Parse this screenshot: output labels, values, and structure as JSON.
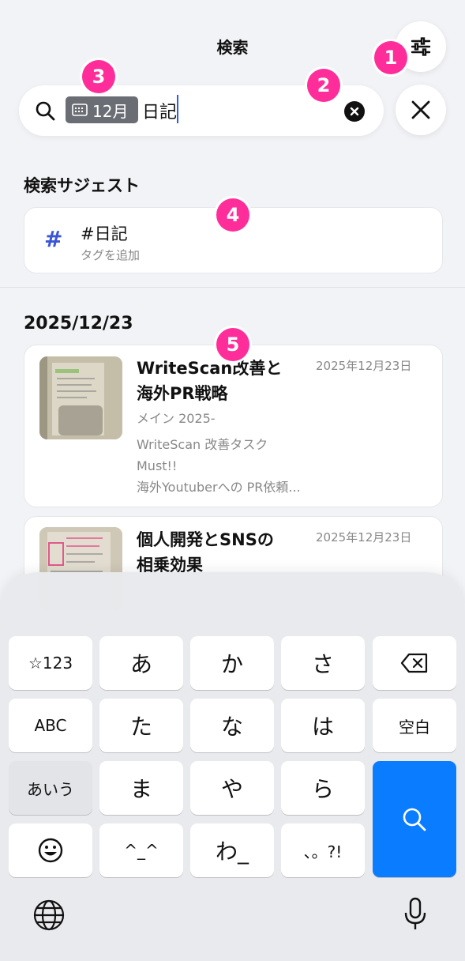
{
  "header": {
    "title": "検索"
  },
  "search": {
    "chip_label": "12月",
    "query": "日記"
  },
  "suggest": {
    "section_label": "検索サジェスト",
    "tag": "#日記",
    "tag_sub": "タグを追加",
    "hash_symbol": "#"
  },
  "results": {
    "date": "2025/12/23",
    "posts": [
      {
        "title_line1": "WriteScan改善と",
        "title_line2": "海外PR戦略",
        "date": "2025年12月23日",
        "body_line1": "メイン 2025-",
        "body_line2": "WriteScan 改善タスク",
        "body_line3": "Must!!",
        "body_line4": "海外Youtuberへの PR依頼..."
      },
      {
        "title_line1": "個人開発とSNSの",
        "title_line2": "相乗効果",
        "date": "2025年12月23日"
      }
    ]
  },
  "badges": [
    "1",
    "2",
    "3",
    "4",
    "5"
  ],
  "keyboard": {
    "row1": [
      "☆123",
      "あ",
      "か",
      "さ"
    ],
    "row2": [
      "ABC",
      "た",
      "な",
      "は",
      "空白"
    ],
    "row3": [
      "あいう",
      "ま",
      "や",
      "ら"
    ],
    "row4": [
      "^_^",
      "わ_",
      "、。?!"
    ]
  },
  "colors": {
    "accent": "#0a7cff",
    "badge": "#ff2d9a",
    "hash": "#3a55d6"
  }
}
